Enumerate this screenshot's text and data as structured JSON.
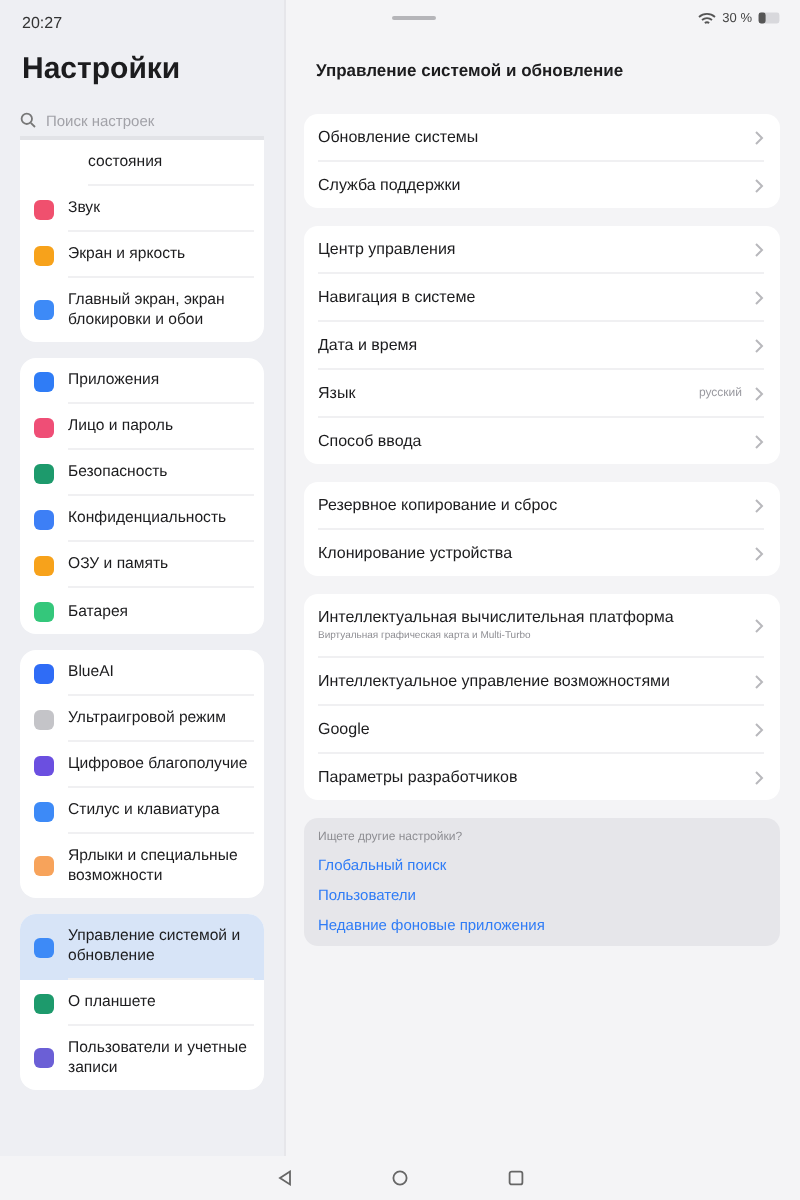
{
  "status_bar": {
    "time": "20:27",
    "battery": "30 %"
  },
  "sidebar": {
    "title": "Настройки",
    "search": {
      "placeholder": "Поиск настроек"
    },
    "groups": [
      {
        "items": [
          {
            "label": "состояния",
            "selected": false
          },
          {
            "label": "Звук",
            "color": "#f0506e",
            "selected": false
          },
          {
            "label": "Экран и яркость",
            "color": "#f7a21b",
            "selected": false
          },
          {
            "label": "Главный экран, экран блокировки и обои",
            "color": "#3d8af7",
            "selected": false
          }
        ]
      },
      {
        "items": [
          {
            "label": "Приложения",
            "color": "#2f7cf6",
            "selected": false
          },
          {
            "label": "Лицо и пароль",
            "color": "#ef4e76",
            "selected": false
          },
          {
            "label": "Безопасность",
            "color": "#1d9a6c",
            "selected": false
          },
          {
            "label": "Конфиденциальность",
            "color": "#3d7ff6",
            "selected": false
          },
          {
            "label": "ОЗУ и память",
            "color": "#f7a21b",
            "selected": false
          },
          {
            "label": "Батарея",
            "color": "#34c77b",
            "selected": false
          }
        ]
      },
      {
        "items": [
          {
            "label": "BlueAI",
            "color": "#2f6cf6",
            "selected": false
          },
          {
            "label": "Ультраигровой режим",
            "color": "#c4c4c8",
            "selected": false
          },
          {
            "label": "Цифровое благополучие",
            "color": "#6b4fe0",
            "selected": false
          },
          {
            "label": "Стилус и клавиатура",
            "color": "#3d8af7",
            "selected": false
          },
          {
            "label": "Ярлыки и специальные возможности",
            "color": "#f7a35b",
            "selected": false
          }
        ]
      },
      {
        "items": [
          {
            "label": "Управление системой и обновление",
            "color": "#3d8af7",
            "selected": true
          },
          {
            "label": "О планшете",
            "color": "#1d9a6c",
            "selected": false
          },
          {
            "label": "Пользователи и учетные записи",
            "color": "#6b5fd6",
            "selected": false
          }
        ]
      }
    ]
  },
  "content": {
    "title": "Управление системой и обновление",
    "groups": [
      {
        "items": [
          {
            "label": "Обновление системы"
          },
          {
            "label": "Служба поддержки"
          }
        ]
      },
      {
        "items": [
          {
            "label": "Центр управления"
          },
          {
            "label": "Навигация в системе"
          },
          {
            "label": "Дата и время"
          },
          {
            "label": "Язык",
            "value": "русский"
          },
          {
            "label": "Способ ввода"
          }
        ]
      },
      {
        "items": [
          {
            "label": "Резервное копирование и сброс"
          },
          {
            "label": "Клонирование устройства"
          }
        ]
      },
      {
        "items": [
          {
            "label": "Интеллектуальная вычислительная платформа",
            "subtitle": "Виртуальная графическая карта и Multi-Turbo"
          },
          {
            "label": "Интеллектуальное управление возможностями"
          },
          {
            "label": "Google"
          },
          {
            "label": "Параметры разработчиков"
          }
        ]
      }
    ],
    "suggestions": {
      "heading": "Ищете другие настройки?",
      "links": [
        "Глобальный поиск",
        "Пользователи",
        "Недавние фоновые приложения"
      ]
    }
  }
}
